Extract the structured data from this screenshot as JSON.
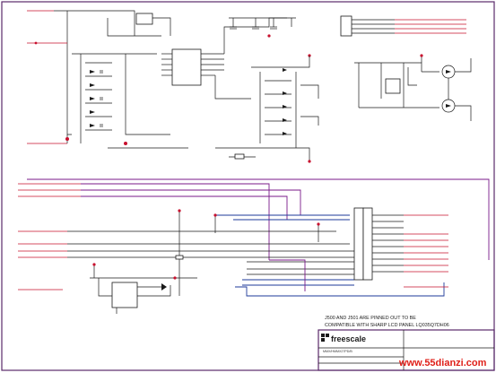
{
  "note": {
    "line1": "J500 AND J501 ARE PINNED OUT TO BE",
    "line2": "COMPATIBLE WITH SHARP LCD PANEL LQ035Q7DH06"
  },
  "title_block": {
    "brand": "freescale",
    "part": "MMX/HMMX27PD/B"
  },
  "watermark": "www.55dianzi.com",
  "colors": {
    "frame": "#5a2a6a",
    "wire": "#1a1a1a",
    "net_label": "#c8102e",
    "bus": "#1e3a9a",
    "watermark": "#e0201a"
  }
}
